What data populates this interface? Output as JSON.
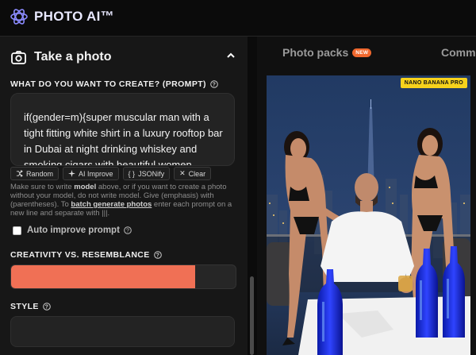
{
  "header": {
    "logo_text": "PHOTO AI™"
  },
  "left_panel": {
    "section_title": "Take a photo",
    "prompt_label": "WHAT DO YOU WANT TO CREATE? (PROMPT)",
    "prompt_value": "if(gender=m){super muscular man with a tight fitting white shirt in a luxury rooftop bar in Dubai at night drinking whiskey and smoking cigars with beautiful women",
    "tools": [
      {
        "label": "Random",
        "icon": "shuffle-icon"
      },
      {
        "label": "AI Improve",
        "icon": "sparkle-icon"
      },
      {
        "label": "JSONify",
        "icon": "braces-icon"
      },
      {
        "label": "Clear",
        "icon": "close-icon"
      }
    ],
    "help": {
      "t1": "Make sure to write ",
      "model": "model",
      "t2": " above, or if you want to create a photo without your model, do not write model. Give (emphasis) with (parentheses). To ",
      "link": "batch generate photos",
      "t3": " enter each prompt on a new line and separate with |||."
    },
    "auto_improve_label": "Auto improve prompt",
    "auto_improve_checked": false,
    "creativity_label": "CREATIVITY VS. RESEMBLANCE",
    "creativity_value": 0.82,
    "style_label": "STYLE",
    "style_value": ""
  },
  "right_panel": {
    "tabs": [
      {
        "label": "Photo packs",
        "badge": "NEW"
      },
      {
        "label": "Comm"
      }
    ],
    "photo_badge": "NANO BANANA PRO"
  },
  "colors": {
    "accent": "#f07055",
    "badge_orange": "#f0682e",
    "badge_yellow": "#f6d21c"
  }
}
